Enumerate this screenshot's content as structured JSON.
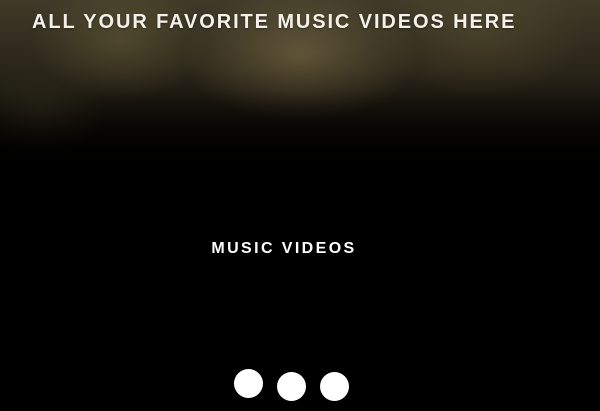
{
  "hero": {
    "title": "ALL YOUR FAVORITE MUSIC VIDEOS HERE",
    "background": "blurred-photo"
  },
  "section": {
    "label": "MUSIC VIDEOS"
  },
  "pagination": {
    "dots": [
      "slide-1",
      "slide-2",
      "slide-3"
    ],
    "dot_color": "#ffffff"
  },
  "colors": {
    "page_background": "#000000",
    "text": "#ffffff"
  }
}
